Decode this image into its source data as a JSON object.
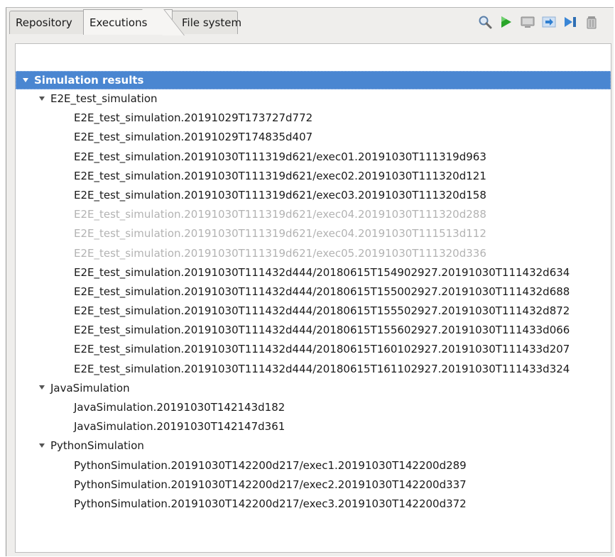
{
  "tabs": {
    "repository": "Repository",
    "executions": "Executions",
    "file_system": "File system"
  },
  "toolbar": {
    "icons": [
      "search-icon",
      "run-icon",
      "monitor-icon",
      "step-icon",
      "skip-icon",
      "trash-icon"
    ]
  },
  "tree": {
    "root": "Simulation results",
    "groups": [
      {
        "label": "E2E_test_simulation",
        "items": [
          {
            "label": "E2E_test_simulation.20191029T173727d772",
            "dim": false
          },
          {
            "label": "E2E_test_simulation.20191029T174835d407",
            "dim": false
          },
          {
            "label": "E2E_test_simulation.20191030T111319d621/exec01.20191030T111319d963",
            "dim": false
          },
          {
            "label": "E2E_test_simulation.20191030T111319d621/exec02.20191030T111320d121",
            "dim": false
          },
          {
            "label": "E2E_test_simulation.20191030T111319d621/exec03.20191030T111320d158",
            "dim": false
          },
          {
            "label": "E2E_test_simulation.20191030T111319d621/exec04.20191030T111320d288",
            "dim": true
          },
          {
            "label": "E2E_test_simulation.20191030T111319d621/exec04.20191030T111513d112",
            "dim": true
          },
          {
            "label": "E2E_test_simulation.20191030T111319d621/exec05.20191030T111320d336",
            "dim": true
          },
          {
            "label": "E2E_test_simulation.20191030T111432d444/20180615T154902927.20191030T111432d634",
            "dim": false
          },
          {
            "label": "E2E_test_simulation.20191030T111432d444/20180615T155002927.20191030T111432d688",
            "dim": false
          },
          {
            "label": "E2E_test_simulation.20191030T111432d444/20180615T155502927.20191030T111432d872",
            "dim": false
          },
          {
            "label": "E2E_test_simulation.20191030T111432d444/20180615T155602927.20191030T111433d066",
            "dim": false
          },
          {
            "label": "E2E_test_simulation.20191030T111432d444/20180615T160102927.20191030T111433d207",
            "dim": false
          },
          {
            "label": "E2E_test_simulation.20191030T111432d444/20180615T161102927.20191030T111433d324",
            "dim": false
          }
        ]
      },
      {
        "label": "JavaSimulation",
        "items": [
          {
            "label": "JavaSimulation.20191030T142143d182",
            "dim": false
          },
          {
            "label": "JavaSimulation.20191030T142147d361",
            "dim": false
          }
        ]
      },
      {
        "label": "PythonSimulation",
        "items": [
          {
            "label": "PythonSimulation.20191030T142200d217/exec1.20191030T142200d289",
            "dim": false
          },
          {
            "label": "PythonSimulation.20191030T142200d217/exec2.20191030T142200d337",
            "dim": false
          },
          {
            "label": "PythonSimulation.20191030T142200d217/exec3.20191030T142200d372",
            "dim": false
          }
        ]
      }
    ]
  },
  "colors": {
    "selection": "#4a86d1",
    "dimmed_text": "#b3b3b3",
    "run_green": "#2aa52a"
  }
}
